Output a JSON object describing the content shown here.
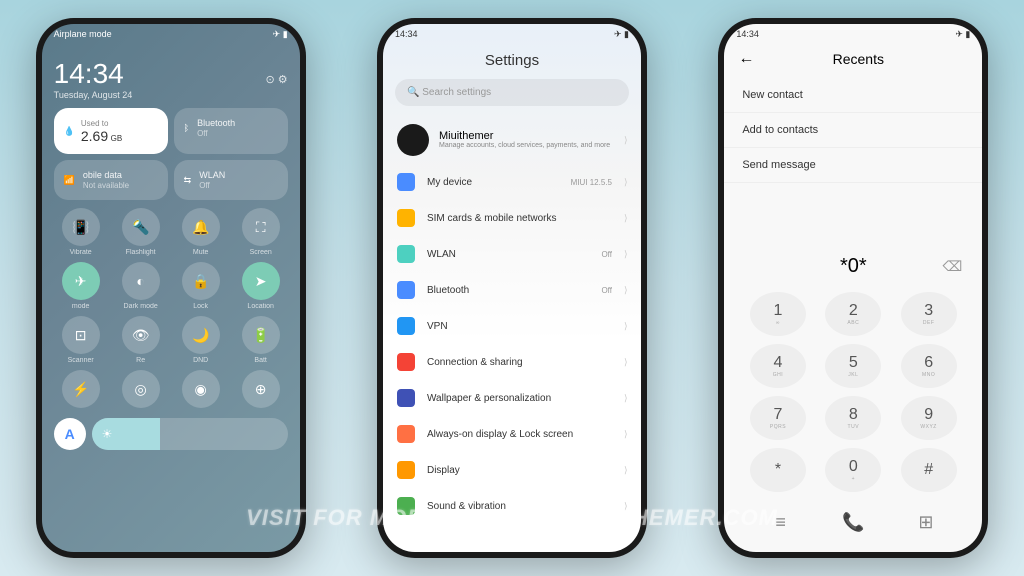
{
  "status_time": "14:34",
  "cc": {
    "mode": "Airplane mode",
    "time": "14:34",
    "date": "Tuesday, August 24",
    "data_label": "Used to",
    "data_value": "2.69",
    "data_unit": "GB",
    "bt_label": "Bluetooth",
    "bt_status": "Off",
    "mobile_label": "obile data",
    "mobile_status": "Not available",
    "wlan_label": "WLAN",
    "wlan_status": "Off",
    "toggles": [
      "Vibrate",
      "Flashlight",
      "Mute",
      "Screen",
      "mode",
      "Dark mode",
      "Lock",
      "Location",
      "Scanner",
      "Re",
      "DND",
      "Batt"
    ],
    "brightness_letter": "A"
  },
  "settings": {
    "title": "Settings",
    "search_placeholder": "Search settings",
    "account_name": "Miuithemer",
    "account_sub": "Manage accounts, cloud services, payments, and more",
    "items": [
      {
        "icon_color": "#4a8cff",
        "label": "My device",
        "value": "MIUI 12.5.5"
      },
      {
        "icon_color": "#ffb300",
        "label": "SIM cards & mobile networks",
        "value": ""
      },
      {
        "icon_color": "#4dd0c0",
        "label": "WLAN",
        "value": "Off"
      },
      {
        "icon_color": "#4a8cff",
        "label": "Bluetooth",
        "value": "Off"
      },
      {
        "icon_color": "#2196f3",
        "label": "VPN",
        "value": ""
      },
      {
        "icon_color": "#f44336",
        "label": "Connection & sharing",
        "value": ""
      },
      {
        "icon_color": "#3f51b5",
        "label": "Wallpaper & personalization",
        "value": ""
      },
      {
        "icon_color": "#ff7043",
        "label": "Always-on display & Lock screen",
        "value": ""
      },
      {
        "icon_color": "#ff9800",
        "label": "Display",
        "value": ""
      },
      {
        "icon_color": "#4caf50",
        "label": "Sound & vibration",
        "value": ""
      }
    ]
  },
  "dialer": {
    "title": "Recents",
    "menu": [
      "New contact",
      "Add to contacts",
      "Send message"
    ],
    "number": "*0*",
    "keys": [
      {
        "n": "1",
        "s": "∞"
      },
      {
        "n": "2",
        "s": "ABC"
      },
      {
        "n": "3",
        "s": "DEF"
      },
      {
        "n": "4",
        "s": "GHI"
      },
      {
        "n": "5",
        "s": "JKL"
      },
      {
        "n": "6",
        "s": "MNO"
      },
      {
        "n": "7",
        "s": "PQRS"
      },
      {
        "n": "8",
        "s": "TUV"
      },
      {
        "n": "9",
        "s": "WXYZ"
      },
      {
        "n": "*",
        "s": ""
      },
      {
        "n": "0",
        "s": "+"
      },
      {
        "n": "#",
        "s": ""
      }
    ]
  },
  "watermark": "VISIT FOR MORE THEMES - MIUITHEMER.COM"
}
